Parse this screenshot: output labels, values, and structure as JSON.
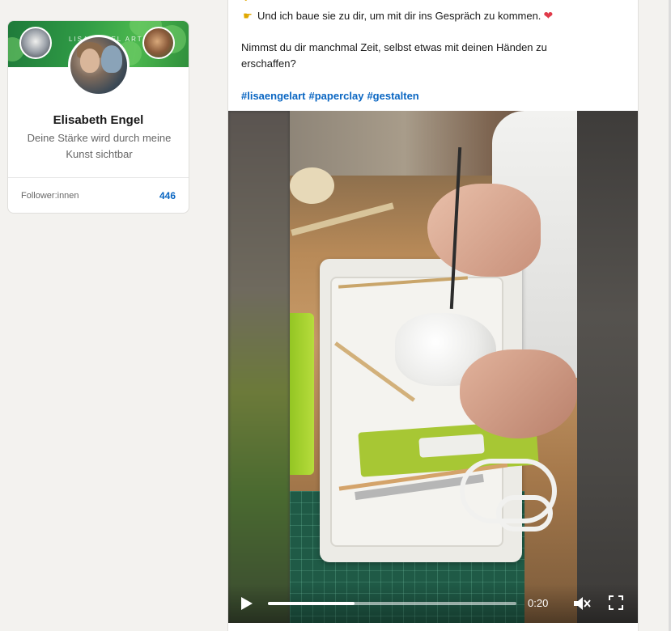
{
  "profile": {
    "name": "Elisabeth Engel",
    "tagline": "Deine Stärke wird durch meine Kunst sichtbar",
    "follower_label": "Follower:innen",
    "follower_count": "446",
    "cover_brand": "LISA ENGEL ART"
  },
  "post": {
    "line1": "Und ich baue sie zu dir, um mit dir ins Gespräch zu kommen.",
    "line2": "Nimmst du dir manchmal Zeit, selbst etwas mit deinen Händen zu",
    "line3": "erschaffen?",
    "hashtags": [
      "#lisaengelart",
      "#paperclay",
      "#gestalten"
    ],
    "icons": {
      "pointing": "pointing-hand-icon",
      "heart": "red-heart-icon"
    }
  },
  "video": {
    "time": "0:20",
    "progress": 0.35,
    "icons": [
      "play-icon",
      "mute-icon",
      "fullscreen-icon"
    ]
  },
  "colors": {
    "link": "#0a66c2",
    "background": "#f3f2ef",
    "cover_green": "#2f9a45"
  }
}
